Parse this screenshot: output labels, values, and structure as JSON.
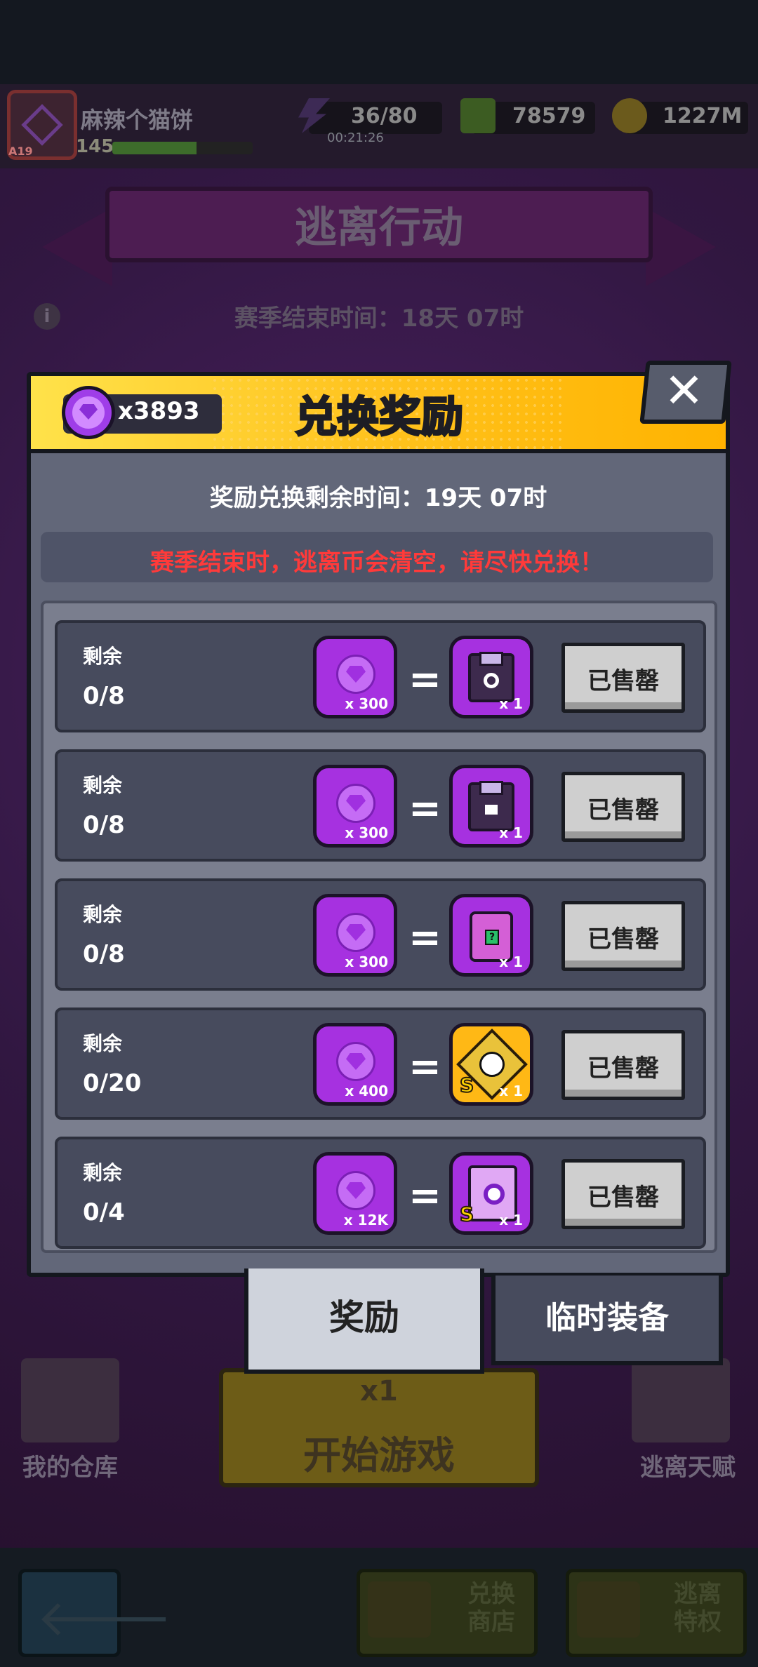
{
  "topbar": {
    "player_name": "麻辣个猫饼",
    "player_level": "145",
    "avatar_level_tag": "A19",
    "energy": "36/80",
    "energy_timer": "00:21:26",
    "cubes": "78579",
    "coins": "1227M",
    "xp_progress": 0.6
  },
  "background": {
    "event_title": "逃离行动",
    "season_end": "赛季结束时间：18天 07时",
    "info_icon": "i",
    "warehouse_label": "我的仓库",
    "start_cost": "x1",
    "start_label": "开始游戏",
    "talent_label": "逃离天赋",
    "shop_label": "兑换\n商店",
    "privilege_label": "逃离\n特权"
  },
  "dialog": {
    "title": "兑换奖励",
    "gem_count": "x3893",
    "close_symbol": "✕",
    "time_left": "奖励兑换剩余时间：19天 07时",
    "warning": "赛季结束时，逃离币会清空，请尽快兑换！",
    "eq": "=",
    "rows": [
      {
        "remain_label": "剩余",
        "remain": "0/8",
        "cost": "x 300",
        "reward_qty": "x 1",
        "reward_icon": "gear-chest-icon",
        "button": "已售罄"
      },
      {
        "remain_label": "剩余",
        "remain": "0/8",
        "cost": "x 300",
        "reward_qty": "x 1",
        "reward_icon": "robot-chest-icon",
        "button": "已售罄"
      },
      {
        "remain_label": "剩余",
        "remain": "0/8",
        "cost": "x 300",
        "reward_qty": "x 1",
        "reward_icon": "mystery-case-icon",
        "button": "已售罄"
      },
      {
        "remain_label": "剩余",
        "remain": "0/20",
        "cost": "x 400",
        "reward_qty": "x 1",
        "reward_icon": "skull-emblem-icon",
        "reward_grade": "S",
        "button": "已售罄"
      },
      {
        "remain_label": "剩余",
        "remain": "0/4",
        "cost": "x 12K",
        "reward_qty": "x 1",
        "reward_icon": "camera-device-icon",
        "reward_grade": "S",
        "button": "已售罄"
      }
    ],
    "tabs": [
      {
        "label": "奖励",
        "active": true
      },
      {
        "label": "临时装备",
        "active": false
      }
    ]
  },
  "colors": {
    "header_yellow": "#ffc21d",
    "gem_purple": "#a631e0",
    "warning_red": "#ff3a3a",
    "panel_gray": "#626779"
  }
}
